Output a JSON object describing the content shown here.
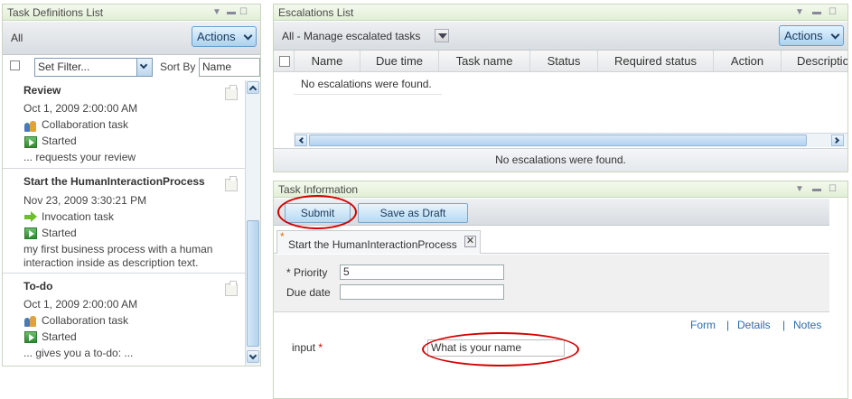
{
  "colors": {
    "accent": "#2b6cb0",
    "portlet_title_bg": "#e2efd6",
    "highlight_ellipse": "#d40000",
    "started_green": "#2f8a2f"
  },
  "task_definitions": {
    "title": "Task Definitions List",
    "filter_label": "All",
    "actions_label": "Actions",
    "set_filter_value": "Set Filter...",
    "sort_by_label": "Sort By",
    "sort_by_value": "Name",
    "items": [
      {
        "title": "Review",
        "date": "Oct 1, 2009 2:00:00 AM",
        "type": "Collaboration task",
        "type_icon": "collaboration-icon",
        "status": "Started",
        "description": "... requests your review"
      },
      {
        "title": "Start the HumanInteractionProcess",
        "date": "Nov 23, 2009 3:30:21 PM",
        "type": "Invocation task",
        "type_icon": "arrow-icon",
        "status": "Started",
        "description": "my first business process with a human",
        "description2": "interaction inside as description text."
      },
      {
        "title": "To-do",
        "date": "Oct 1, 2009 2:00:00 AM",
        "type": "Collaboration task",
        "type_icon": "collaboration-icon",
        "status": "Started",
        "description": "... gives you a to-do: ..."
      }
    ]
  },
  "escalations": {
    "title": "Escalations List",
    "filter_label": "All - Manage escalated tasks",
    "actions_label": "Actions",
    "columns": [
      "Name",
      "Due time",
      "Task name",
      "Status",
      "Required status",
      "Action",
      "Descriptio"
    ],
    "empty_message": "No escalations were found.",
    "footer_message": "No escalations were found."
  },
  "task_info": {
    "title": "Task Information",
    "submit_label": "Submit",
    "save_draft_label": "Save as Draft",
    "tab_marker": "*",
    "tab_label": "Start the HumanInteractionProcess",
    "priority_label": "* Priority",
    "priority_value": "5",
    "due_date_label": "Due date",
    "due_date_value": "",
    "links": {
      "form": "Form",
      "details": "Details",
      "notes": "Notes",
      "separator": "|"
    },
    "input_label": "input",
    "input_required": "*",
    "input_value": "What is your name"
  }
}
